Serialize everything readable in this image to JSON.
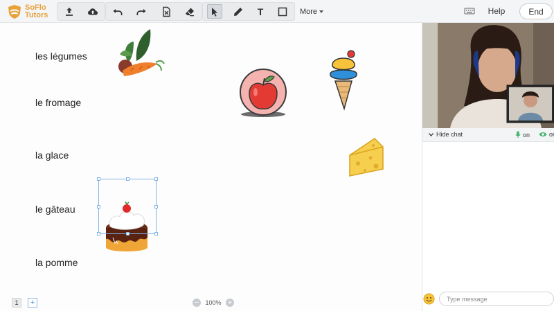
{
  "app": {
    "brand_line1": "SoFlo",
    "brand_line2": "Tutors"
  },
  "toolbar": {
    "tools": [
      {
        "name": "upload-icon"
      },
      {
        "name": "cloud-icon"
      },
      {
        "name": "undo-icon"
      },
      {
        "name": "redo-icon"
      },
      {
        "name": "clear-page-icon"
      },
      {
        "name": "eraser-icon"
      },
      {
        "name": "select-pointer-icon"
      },
      {
        "name": "pencil-icon"
      },
      {
        "name": "text-tool-icon"
      },
      {
        "name": "shape-tool-icon"
      }
    ],
    "text_tool_label": "T",
    "more_label": "More",
    "help_label": "Help",
    "end_label": "End",
    "active_tool": "select-pointer-icon"
  },
  "board": {
    "words": [
      {
        "id": "legumes",
        "text": "les légumes"
      },
      {
        "id": "fromage",
        "text": "le fromage"
      },
      {
        "id": "glace",
        "text": "la glace"
      },
      {
        "id": "gateau",
        "text": "le gâteau"
      },
      {
        "id": "pomme",
        "text": "la pomme"
      }
    ],
    "stickers": [
      "vegetables-sticker",
      "apple-sticker",
      "ice-cream-sticker",
      "cheese-sticker",
      "cake-sticker"
    ],
    "selected_sticker": "cake-sticker"
  },
  "footer": {
    "page_number": "1",
    "add_page_label": "+",
    "zoom_out_label": "−",
    "zoom_in_label": "+",
    "zoom_level": "100%"
  },
  "chat": {
    "hide_chat_label": "Hide chat",
    "mic_label": "on",
    "cam_label": "on",
    "message_placeholder": "Type message"
  },
  "colors": {
    "brand": "#e8a13b",
    "toolbar_bg": "#f4f5f6",
    "status_green": "#3bb36a",
    "selection": "#7fb3e6"
  }
}
